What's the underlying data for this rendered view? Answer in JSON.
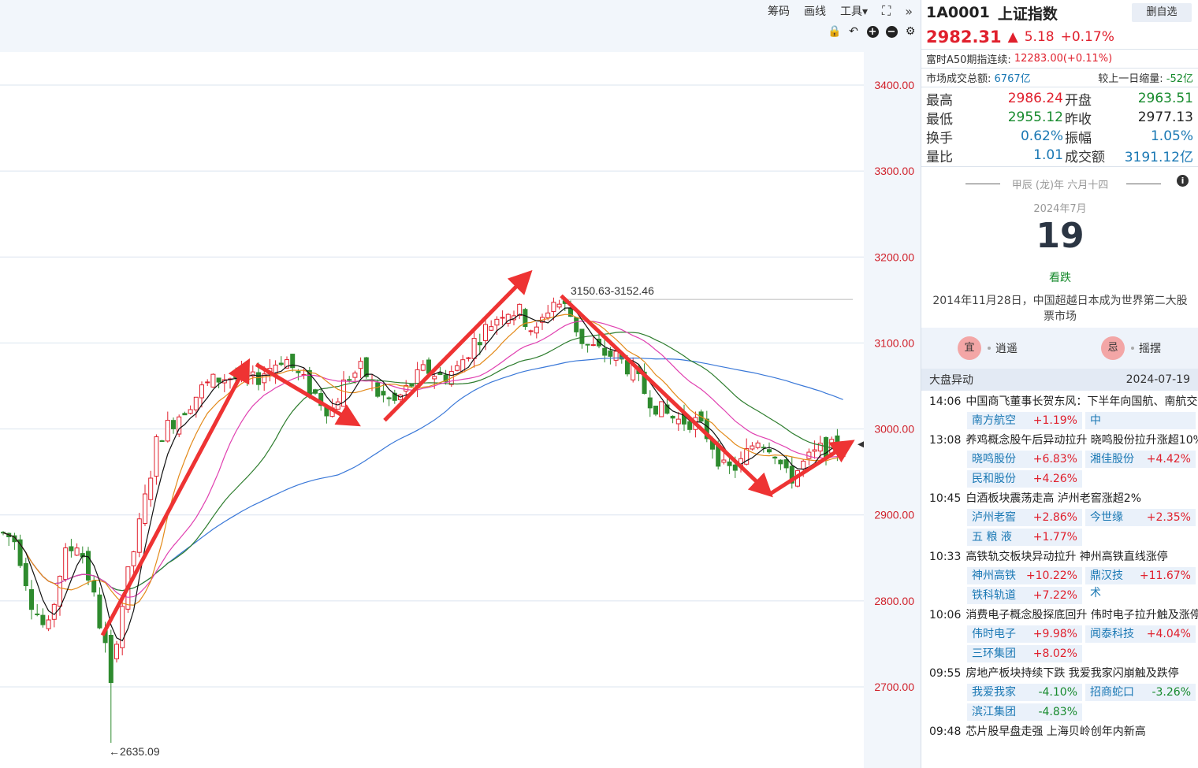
{
  "toolbar": {
    "chip_label": "筹码",
    "draw_label": "画线",
    "tools_label": "工具▾",
    "expand_icon": "expand-icon",
    "collapse_icon": "double-chevron-right-icon"
  },
  "subbar": {
    "icons": [
      "lock-icon",
      "undo-icon",
      "zoom-in-icon",
      "zoom-out-icon",
      "gear-icon"
    ]
  },
  "quote": {
    "code": "1A0001",
    "name": "上证指数",
    "remove_btn": "删自选",
    "price": "2982.31",
    "arrow": "🡅",
    "change": "5.18",
    "change_pct": "+0.17%",
    "a50_label": "富时A50期指连续:",
    "a50_value": "12283.00(+0.11%)",
    "turnover_label": "市场成交总额:",
    "turnover_value": "6767亿",
    "shrink_label": "较上一日缩量:",
    "shrink_value": "-52亿"
  },
  "stats": [
    {
      "l1": "最高",
      "v1": "2986.24",
      "c1": "red",
      "l2": "开盘",
      "v2": "2963.51",
      "c2": "green"
    },
    {
      "l1": "最低",
      "v1": "2955.12",
      "c1": "green",
      "l2": "昨收",
      "v2": "2977.13",
      "c2": "dark"
    },
    {
      "l1": "换手",
      "v1": "0.62%",
      "c1": "blue",
      "l2": "振幅",
      "v2": "1.05%",
      "c2": "blue"
    },
    {
      "l1": "量比",
      "v1": "1.01",
      "c1": "blue",
      "l2": "成交额",
      "v2": "3191.12亿",
      "c2": "blue"
    }
  ],
  "calendar": {
    "lunar": "甲辰 (龙)年 六月十四",
    "month": "2024年7月",
    "day": "19",
    "mood": "看跌",
    "event": "2014年11月28日，中国超越日本成为世界第二大股票市场",
    "yi": "宜",
    "yi_text": "逍遥",
    "ji": "忌",
    "ji_text": "摇摆"
  },
  "news": {
    "header": "大盘异动",
    "date": "2024-07-19",
    "items": [
      {
        "time": "14:06",
        "title": "中国商飞董事长贺东风：下半年向国航、南航交付",
        "tags": [
          {
            "name": "南方航空",
            "pct": "+1.19%",
            "c": "red"
          },
          {
            "name": "中",
            "pct": "",
            "c": "red"
          }
        ]
      },
      {
        "time": "13:08",
        "title": "养鸡概念股午后异动拉升 晓鸣股份拉升涨超10%",
        "tags": [
          {
            "name": "晓鸣股份",
            "pct": "+6.83%",
            "c": "red"
          },
          {
            "name": "湘佳股份",
            "pct": "+4.42%",
            "c": "red"
          },
          {
            "name": "民和股份",
            "pct": "+4.26%",
            "c": "red"
          }
        ]
      },
      {
        "time": "10:45",
        "title": "白酒板块震荡走高 泸州老窖涨超2%",
        "tags": [
          {
            "name": "泸州老窖",
            "pct": "+2.86%",
            "c": "red"
          },
          {
            "name": "今世缘",
            "pct": "+2.35%",
            "c": "red"
          },
          {
            "name": "五 粮 液",
            "pct": "+1.77%",
            "c": "red"
          }
        ]
      },
      {
        "time": "10:33",
        "title": "高铁轨交板块异动拉升 神州高铁直线涨停",
        "tags": [
          {
            "name": "神州高铁",
            "pct": "+10.22%",
            "c": "red"
          },
          {
            "name": "鼎汉技术",
            "pct": "+11.67%",
            "c": "red"
          },
          {
            "name": "铁科轨道",
            "pct": "+7.22%",
            "c": "red"
          }
        ]
      },
      {
        "time": "10:06",
        "title": "消费电子概念股探底回升 伟时电子拉升触及涨停",
        "tags": [
          {
            "name": "伟时电子",
            "pct": "+9.98%",
            "c": "red"
          },
          {
            "name": "闻泰科技",
            "pct": "+4.04%",
            "c": "red"
          },
          {
            "name": "三环集团",
            "pct": "+8.02%",
            "c": "red"
          }
        ]
      },
      {
        "time": "09:55",
        "title": "房地产板块持续下跌 我爱我家闪崩触及跌停",
        "tags": [
          {
            "name": "我爱我家",
            "pct": "-4.10%",
            "c": "green"
          },
          {
            "name": "招商蛇口",
            "pct": "-3.26%",
            "c": "green"
          },
          {
            "name": "滨江集团",
            "pct": "-4.83%",
            "c": "green"
          }
        ]
      },
      {
        "time": "09:48",
        "title": "芯片股早盘走强 上海贝岭创年内新高",
        "tags": []
      }
    ]
  },
  "chart_data": {
    "type": "candlestick",
    "y_ticks": [
      "3400.00",
      "3300.00",
      "3200.00",
      "3100.00",
      "3000.00",
      "2900.00",
      "2800.00",
      "2700.00"
    ],
    "ylim": [
      2620,
      3440
    ],
    "annotations": {
      "high_label": "3150.63-3152.46",
      "low_label": "←2635.09"
    },
    "colors": {
      "up": "#e0202d",
      "down": "#2e8b2e",
      "ma5": "#111111",
      "ma10": "#e38a1a",
      "ma20": "#e040b0",
      "ma30": "#2e7d2e",
      "ma60": "#3a78d8",
      "arrow": "#ee3333"
    }
  }
}
